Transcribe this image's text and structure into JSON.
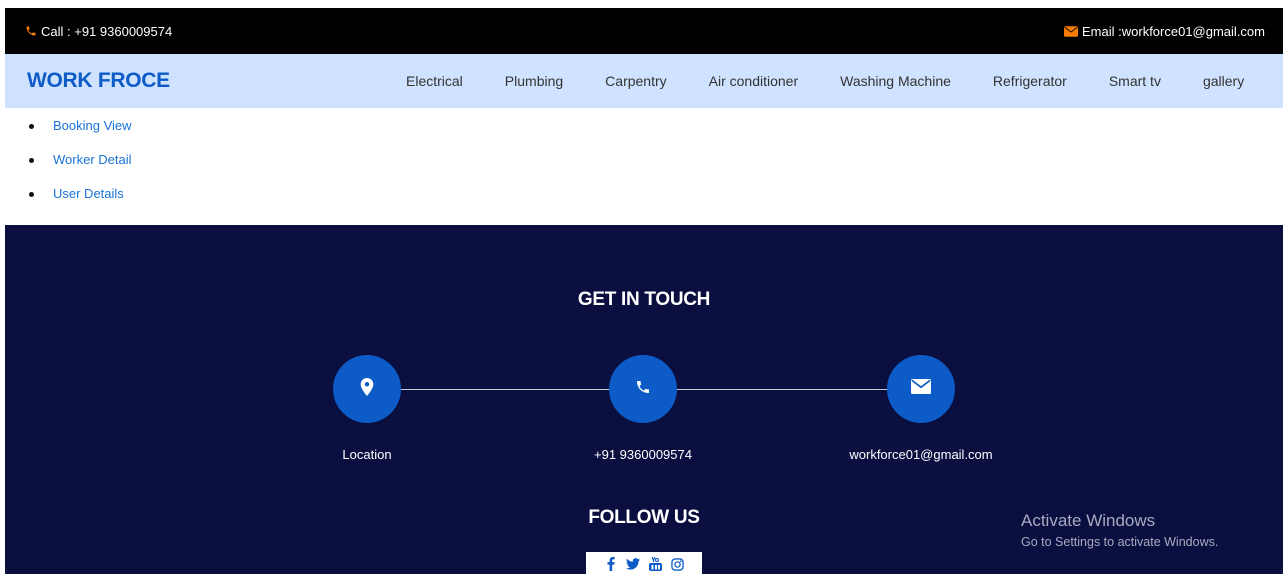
{
  "topbar": {
    "call_label": "Call : +91 9360009574",
    "email_label": "Email :workforce01@gmail.com",
    "accent_color": "#f57c00",
    "call_icon": "phone-icon",
    "email_icon": "envelope-icon"
  },
  "navbar": {
    "brand": "WORK FROCE",
    "brand_color": "#0d5bc6",
    "links": [
      "Electrical",
      "Plumbing",
      "Carpentry",
      "Air conditioner",
      "Washing Machine",
      "Refrigerator",
      "Smart tv",
      "gallery"
    ]
  },
  "admin_list": {
    "items": [
      "Booking View",
      "Worker Detail",
      "User Details"
    ]
  },
  "footer": {
    "background_color": "#0a0f40",
    "get_in_touch": "GET IN TOUCH",
    "contacts": [
      {
        "icon": "location-pin-icon",
        "label": "Location"
      },
      {
        "icon": "phone-icon",
        "label": "+91 9360009574"
      },
      {
        "icon": "envelope-icon",
        "label": "workforce01@gmail.com"
      }
    ],
    "follow_us": "FOLLOW US",
    "social_icons": [
      "facebook-icon",
      "twitter-icon",
      "youtube-icon",
      "instagram-icon"
    ]
  },
  "watermark": {
    "title": "Activate Windows",
    "subtitle": "Go to Settings to activate Windows."
  }
}
